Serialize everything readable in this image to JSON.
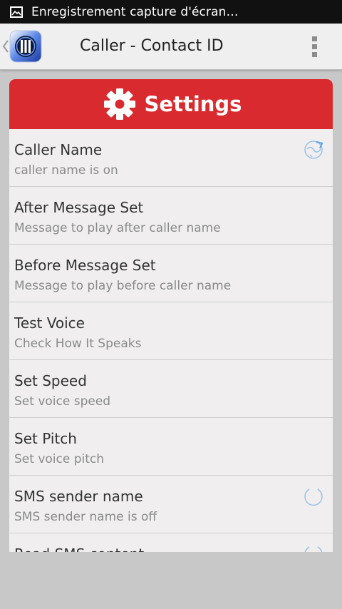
{
  "status_bar": {
    "notification_text": "Enregistrement capture d'écran…",
    "icon": "screenshot-image-icon"
  },
  "action_bar": {
    "title": "Caller - Contact ID",
    "back_icon": "chevron-left-icon",
    "app_icon": "app-logo-icon",
    "menu_icon": "overflow-menu-icon"
  },
  "settings_header": {
    "title": "Settings",
    "icon": "gear-icon",
    "color": "#d92b2f"
  },
  "settings": [
    {
      "title": "Caller Name",
      "summary": "caller name is on",
      "widget": "toggle-on-icon"
    },
    {
      "title": "After Message Set",
      "summary": "Message to play after caller name",
      "widget": ""
    },
    {
      "title": "Before Message Set",
      "summary": "Message to play before caller name",
      "widget": ""
    },
    {
      "title": "Test Voice",
      "summary": "Check How It Speaks",
      "widget": ""
    },
    {
      "title": "Set Speed",
      "summary": "Set voice speed",
      "widget": ""
    },
    {
      "title": "Set Pitch",
      "summary": "Set voice pitch",
      "widget": ""
    },
    {
      "title": "SMS sender name",
      "summary": "SMS sender name is off",
      "widget": "toggle-off-icon"
    },
    {
      "title": "Read SMS content",
      "summary": "",
      "widget": "toggle-off-icon"
    }
  ]
}
